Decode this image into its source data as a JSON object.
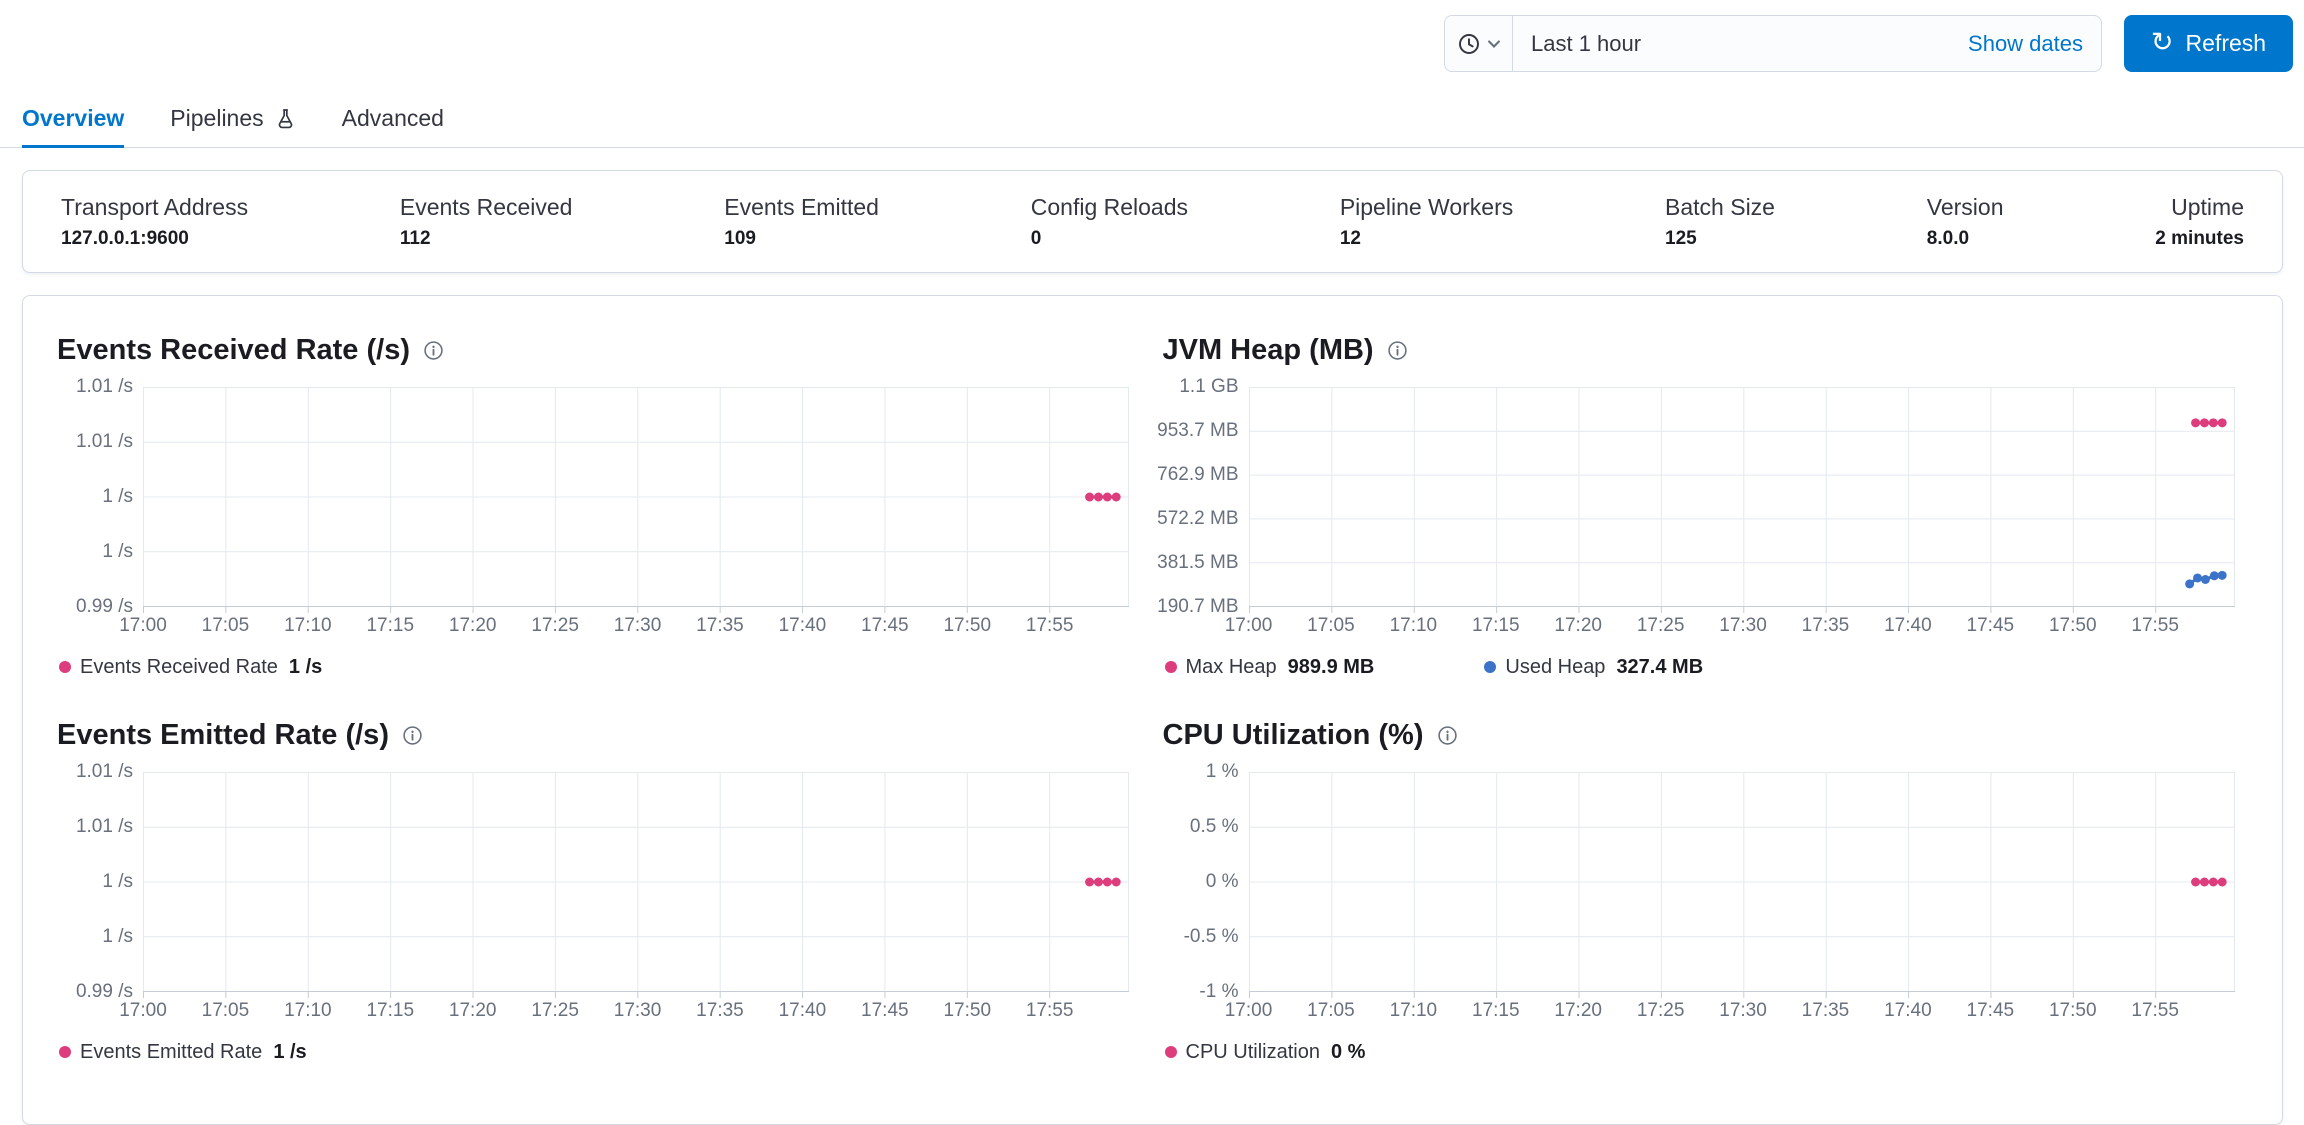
{
  "header": {
    "time_picker": {
      "selected": "Last 1 hour",
      "show_dates_label": "Show dates"
    },
    "refresh_label": "Refresh"
  },
  "tabs": [
    {
      "label": "Overview",
      "active": true
    },
    {
      "label": "Pipelines",
      "active": false,
      "icon": "beaker-icon"
    },
    {
      "label": "Advanced",
      "active": false
    }
  ],
  "summary": [
    {
      "label": "Transport Address",
      "value": "127.0.0.1:9600"
    },
    {
      "label": "Events Received",
      "value": "112"
    },
    {
      "label": "Events Emitted",
      "value": "109"
    },
    {
      "label": "Config Reloads",
      "value": "0"
    },
    {
      "label": "Pipeline Workers",
      "value": "12"
    },
    {
      "label": "Batch Size",
      "value": "125"
    },
    {
      "label": "Version",
      "value": "8.0.0"
    },
    {
      "label": "Uptime",
      "value": "2 minutes"
    }
  ],
  "colors": {
    "accent": "#0077cc",
    "panel_border": "#d3dae6",
    "series_pink": "#dd3c7d",
    "series_blue": "#3b73c9",
    "tick_label": "#69707d"
  },
  "icons": {
    "time_picker": [
      "clock-icon",
      "chevron-down-icon"
    ],
    "refresh_button": "refresh-icon",
    "pipelines_tab": "beaker-icon",
    "chart_titles": "info-icon"
  },
  "charts": [
    {
      "title": "Events Received Rate (/s)",
      "type": "line",
      "y_ticks": [
        "1.01 /s",
        "1.01 /s",
        "1 /s",
        "1 /s",
        "0.99 /s"
      ],
      "x_ticks": [
        "17:00",
        "17:05",
        "17:10",
        "17:15",
        "17:20",
        "17:25",
        "17:30",
        "17:35",
        "17:40",
        "17:45",
        "17:50",
        "17:55"
      ],
      "series": [
        {
          "name": "Events Received Rate",
          "value_label": "1 /s",
          "color": "#dd3c7d",
          "points": [
            [
              0.96,
              0.5
            ],
            [
              0.969,
              0.5
            ],
            [
              0.978,
              0.5
            ],
            [
              0.987,
              0.5
            ]
          ]
        }
      ]
    },
    {
      "title": "JVM Heap (MB)",
      "type": "line",
      "y_ticks": [
        "1.1 GB",
        "953.7 MB",
        "762.9 MB",
        "572.2 MB",
        "381.5 MB",
        "190.7 MB"
      ],
      "x_ticks": [
        "17:00",
        "17:05",
        "17:10",
        "17:15",
        "17:20",
        "17:25",
        "17:30",
        "17:35",
        "17:40",
        "17:45",
        "17:50",
        "17:55"
      ],
      "series": [
        {
          "name": "Max Heap",
          "value_label": "989.9 MB",
          "color": "#dd3c7d",
          "points": [
            [
              0.96,
              0.163
            ],
            [
              0.969,
              0.163
            ],
            [
              0.978,
              0.163
            ],
            [
              0.987,
              0.163
            ]
          ]
        },
        {
          "name": "Used Heap",
          "value_label": "327.4 MB",
          "color": "#3b73c9",
          "points": [
            [
              0.954,
              0.895
            ],
            [
              0.962,
              0.868
            ],
            [
              0.97,
              0.875
            ],
            [
              0.979,
              0.858
            ],
            [
              0.987,
              0.856
            ]
          ]
        }
      ]
    },
    {
      "title": "Events Emitted Rate (/s)",
      "type": "line",
      "y_ticks": [
        "1.01 /s",
        "1.01 /s",
        "1 /s",
        "1 /s",
        "0.99 /s"
      ],
      "x_ticks": [
        "17:00",
        "17:05",
        "17:10",
        "17:15",
        "17:20",
        "17:25",
        "17:30",
        "17:35",
        "17:40",
        "17:45",
        "17:50",
        "17:55"
      ],
      "series": [
        {
          "name": "Events Emitted Rate",
          "value_label": "1 /s",
          "color": "#dd3c7d",
          "points": [
            [
              0.96,
              0.5
            ],
            [
              0.969,
              0.5
            ],
            [
              0.978,
              0.5
            ],
            [
              0.987,
              0.5
            ]
          ]
        }
      ]
    },
    {
      "title": "CPU Utilization (%)",
      "type": "line",
      "y_ticks": [
        "1 %",
        "0.5 %",
        "0 %",
        "-0.5 %",
        "-1 %"
      ],
      "x_ticks": [
        "17:00",
        "17:05",
        "17:10",
        "17:15",
        "17:20",
        "17:25",
        "17:30",
        "17:35",
        "17:40",
        "17:45",
        "17:50",
        "17:55"
      ],
      "series": [
        {
          "name": "CPU Utilization",
          "value_label": "0 %",
          "color": "#dd3c7d",
          "points": [
            [
              0.96,
              0.5
            ],
            [
              0.969,
              0.5
            ],
            [
              0.978,
              0.5
            ],
            [
              0.987,
              0.5
            ]
          ]
        }
      ]
    }
  ]
}
